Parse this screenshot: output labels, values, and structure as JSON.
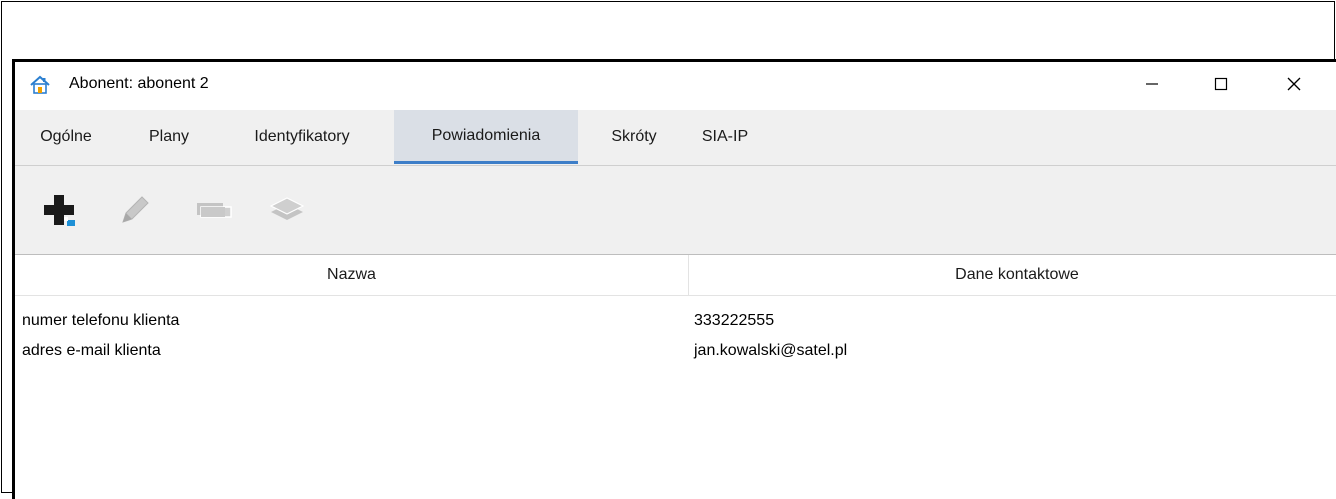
{
  "window": {
    "title": "Abonent: abonent 2",
    "icon": "house-icon",
    "controls": {
      "minimize": "minimize-icon",
      "maximize": "maximize-icon",
      "close": "close-icon"
    }
  },
  "tabs": [
    {
      "label": "Ogólne",
      "active": false
    },
    {
      "label": "Plany",
      "active": false
    },
    {
      "label": "Identyfikatory",
      "active": false
    },
    {
      "label": "Powiadomienia",
      "active": true
    },
    {
      "label": "Skróty",
      "active": false
    },
    {
      "label": "SIA-IP",
      "active": false
    }
  ],
  "toolbar": {
    "buttons": [
      {
        "icon": "add-icon",
        "enabled": true
      },
      {
        "icon": "edit-pencil-icon",
        "enabled": false
      },
      {
        "icon": "remove-icon",
        "enabled": false
      },
      {
        "icon": "layers-icon",
        "enabled": false
      }
    ]
  },
  "table": {
    "columns": [
      "Nazwa",
      "Dane kontaktowe"
    ],
    "rows": [
      [
        "numer telefonu klienta",
        "333222555"
      ],
      [
        "adres e-mail klienta",
        "jan.kowalski@satel.pl"
      ]
    ]
  },
  "colors": {
    "tab_active_bg": "#dadfe6",
    "tab_active_underline": "#3d7ec8",
    "toolbar_bg": "#f0f0f0",
    "icon_accent": "#1e90d6"
  }
}
